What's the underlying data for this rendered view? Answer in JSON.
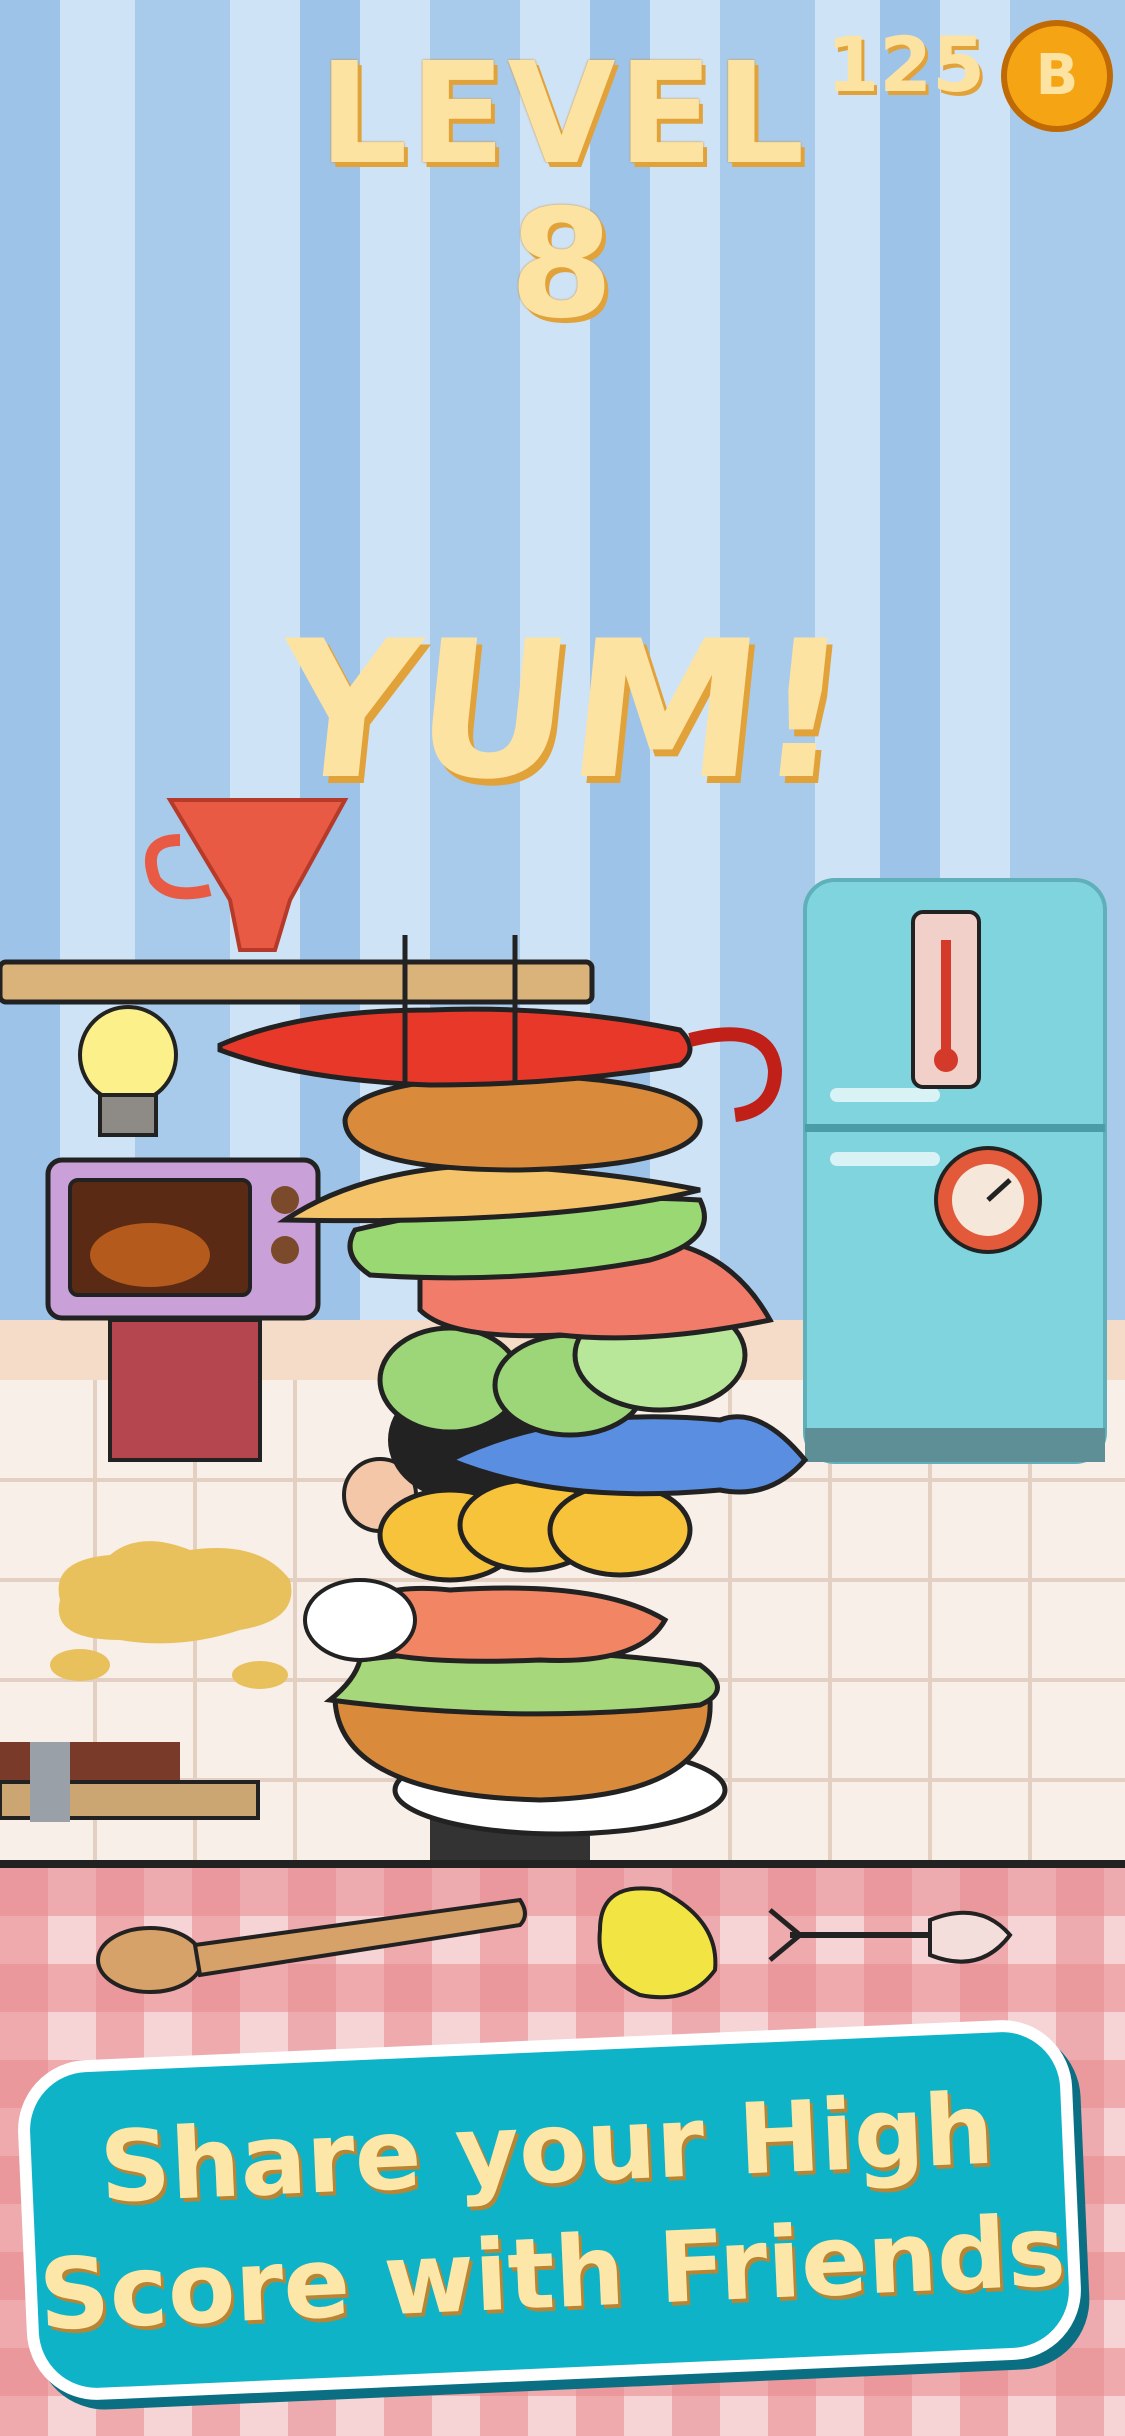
{
  "hud": {
    "level_word": "LEVEL",
    "level_number": "8",
    "coins": "125",
    "coin_symbol": "B"
  },
  "feedback": {
    "text": "YUM!"
  },
  "promo": {
    "line1": "Share your High",
    "line2": "Score with Friends"
  },
  "colors": {
    "wall_light": "#cfe3f6",
    "wall_stripe": "#9ec3e8",
    "title_text": "#fde3a2",
    "title_shadow": "#e2a23a",
    "banner": "#0fb3c7",
    "fridge": "#7fd4dd",
    "tablecloth_red": "#e88a8f"
  },
  "icons": [
    "coin-icon",
    "funnel-icon",
    "lightbulb-icon",
    "microwave-icon",
    "fridge-icon",
    "thermometer-icon",
    "alarm-clock-icon",
    "umbrella-icon",
    "spoon-icon",
    "lemon-icon",
    "fish-bone-icon"
  ]
}
